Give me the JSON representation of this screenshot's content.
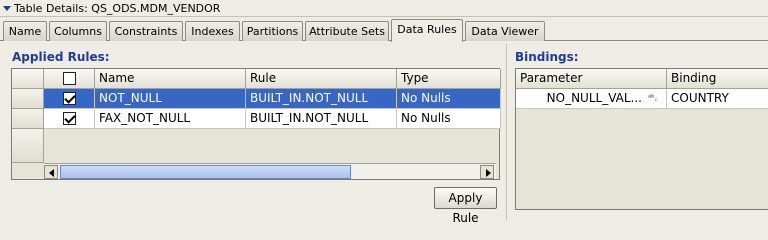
{
  "title": "Table Details: QS_ODS.MDM_VENDOR",
  "tabs": [
    "Name",
    "Columns",
    "Constraints",
    "Indexes",
    "Partitions",
    "Attribute Sets",
    "Data Rules",
    "Data Viewer"
  ],
  "active_tab": "Data Rules",
  "applied_rules": {
    "label": "Applied Rules:",
    "columns": [
      "Name",
      "Rule",
      "Type"
    ],
    "rows": [
      {
        "checked": true,
        "name": "NOT_NULL",
        "rule": "BUILT_IN.NOT_NULL",
        "type": "No Nulls",
        "selected": true
      },
      {
        "checked": true,
        "name": "FAX_NOT_NULL",
        "rule": "BUILT_IN.NOT_NULL",
        "type": "No Nulls",
        "selected": false
      }
    ],
    "apply_button": "Apply Rule"
  },
  "bindings": {
    "label": "Bindings:",
    "columns": [
      "Parameter",
      "Binding"
    ],
    "rows": [
      {
        "parameter": "NO_NULL_VAL...",
        "type_icon": "ᵃᵇ꜀",
        "binding": "COUNTRY"
      }
    ]
  },
  "colors": {
    "selection": "#3767c6",
    "section_title": "#1d3d96"
  }
}
